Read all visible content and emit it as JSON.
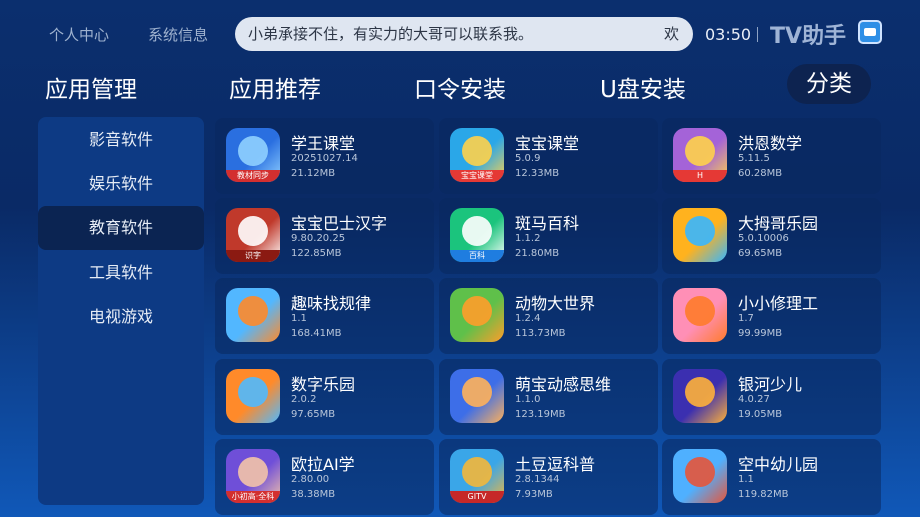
{
  "topbar": {
    "personal": "个人中心",
    "sysinfo": "系统信息",
    "marquee": "小弟承接不住，有实力的大哥可以联系我。",
    "marquee_tail": "欢",
    "time": "03:50",
    "brand": "TV助手",
    "brand_icon": "tv-icon"
  },
  "tabs": [
    {
      "label": "应用管理"
    },
    {
      "label": "应用推荐"
    },
    {
      "label": "口令安装"
    },
    {
      "label": "U盘安装"
    },
    {
      "label": "分类"
    }
  ],
  "sidebar": {
    "items": [
      {
        "label": "影音软件"
      },
      {
        "label": "娱乐软件"
      },
      {
        "label": "教育软件"
      },
      {
        "label": "工具软件"
      },
      {
        "label": "电视游戏"
      }
    ],
    "selected": "教育软件"
  },
  "apps": [
    {
      "name": "学王课堂",
      "version": "20251027.14",
      "size": "21.12MB",
      "icon_label": "教材同步",
      "icon": "robot-icon",
      "color1": "#2a6fe0",
      "color2": "#8fd0ff",
      "label_bg": "#d32f2f"
    },
    {
      "name": "宝宝课堂",
      "version": "5.0.9",
      "size": "12.33MB",
      "icon_label": "宝宝课堂",
      "icon": "child-icon",
      "color1": "#2aa7e8",
      "color2": "#ffd24a",
      "label_bg": "#e53935"
    },
    {
      "name": "洪恩数学",
      "version": "5.11.5",
      "size": "60.28MB",
      "icon_label": "H",
      "icon": "monkey-icon",
      "color1": "#a463d8",
      "color2": "#ffd14a",
      "label_bg": "#e53935"
    },
    {
      "name": "宝宝巴士汉字",
      "version": "9.80.20.25",
      "size": "122.85MB",
      "icon_label": "识字",
      "icon": "panda-icon",
      "color1": "#c0392b",
      "color2": "#ffffff",
      "label_bg": "#8b1a12"
    },
    {
      "name": "斑马百科",
      "version": "1.1.2",
      "size": "21.80MB",
      "icon_label": "百科",
      "icon": "zebra-icon",
      "color1": "#1bc47d",
      "color2": "#ffffff",
      "label_bg": "#1f7de0"
    },
    {
      "name": "大拇哥乐园",
      "version": "5.0.10006",
      "size": "69.65MB",
      "icon_label": "",
      "icon": "thumb-icon",
      "color1": "#ffb21e",
      "color2": "#37b6ff",
      "label_bg": "#ffb21e"
    },
    {
      "name": "趣味找规律",
      "version": "1.1",
      "size": "168.41MB",
      "icon_label": "",
      "icon": "car-icon",
      "color1": "#52b7ff",
      "color2": "#ff8a2a",
      "label_bg": "#52b7ff"
    },
    {
      "name": "动物大世界",
      "version": "1.2.4",
      "size": "113.73MB",
      "icon_label": "",
      "icon": "lion-icon",
      "color1": "#5fc04a",
      "color2": "#ff9d2a",
      "label_bg": "#5fc04a"
    },
    {
      "name": "小小修理工",
      "version": "1.7",
      "size": "99.99MB",
      "icon_label": "",
      "icon": "monkey-icon",
      "color1": "#ff8fb6",
      "color2": "#ff7b2a",
      "label_bg": "#ff8fb6"
    },
    {
      "name": "数字乐园",
      "version": "2.0.2",
      "size": "97.65MB",
      "icon_label": "",
      "icon": "number-icon",
      "color1": "#ff8a2a",
      "color2": "#4fb9ff",
      "label_bg": "#ff8a2a"
    },
    {
      "name": "萌宝动感思维",
      "version": "1.1.0",
      "size": "123.19MB",
      "icon_label": "",
      "icon": "boy-icon",
      "color1": "#3d6ee8",
      "color2": "#ffb15a",
      "label_bg": "#3d6ee8"
    },
    {
      "name": "银河少儿",
      "version": "4.0.27",
      "size": "19.05MB",
      "icon_label": "",
      "icon": "fox-icon",
      "color1": "#3b2fb0",
      "color2": "#ffb13a",
      "label_bg": "#3b2fb0"
    },
    {
      "name": "欧拉AI学",
      "version": "2.80.00",
      "size": "38.38MB",
      "icon_label": "小初高·全科",
      "icon": "girl-icon",
      "color1": "#6f4fd8",
      "color2": "#f3c3a8",
      "label_bg": "#d32f2f"
    },
    {
      "name": "土豆逗科普",
      "version": "2.8.1344",
      "size": "7.93MB",
      "icon_label": "GITV",
      "icon": "fish-icon",
      "color1": "#3aa6e8",
      "color2": "#f4b73a",
      "label_bg": "#c62828"
    },
    {
      "name": "空中幼儿园",
      "version": "1.1",
      "size": "119.82MB",
      "icon_label": "",
      "icon": "monkey-icon",
      "color1": "#4fb0ff",
      "color2": "#e6553a",
      "label_bg": "#4fb0ff"
    }
  ]
}
